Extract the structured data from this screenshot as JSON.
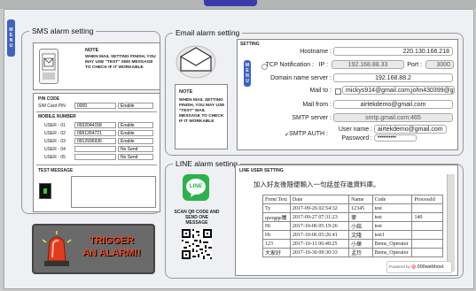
{
  "menu_tab": {
    "letters": [
      "M",
      "E",
      "N",
      "U"
    ]
  },
  "sms": {
    "title": "SMS alarm setting",
    "note_title": "Note",
    "note_text": "When mail setting finish, you may use \"test\" SMS message to check if it workable",
    "pin_label": "PIN code",
    "pin_field_label": "SIM Card PIN",
    "pin_value": "0000",
    "pin_status": "Enable",
    "mobile_label": "Mobile number",
    "users": [
      {
        "label": "USER - 01",
        "number": "0932044158",
        "status": "Enable"
      },
      {
        "label": "USER - 02",
        "number": "0991264721",
        "status": "Enable"
      },
      {
        "label": "USER - 03",
        "number": "0912936936",
        "status": "Enable"
      },
      {
        "label": "USER - 04",
        "number": "",
        "status": "No Send"
      },
      {
        "label": "USER - 05",
        "number": "",
        "status": "No Send"
      }
    ],
    "test_label": "Test message"
  },
  "trigger": {
    "line1": "Trigger",
    "line2": "an alarm!!",
    "color": "#e94a2a"
  },
  "email": {
    "title": "Email alarm setting",
    "setting_label": "Setting",
    "note_title": "Note",
    "note_text": "When mail setting finish, you may use \"test\" mail message to check if it workable",
    "hostname_label": "Hostname :",
    "hostname_value": "220.130.166.218",
    "tcp_label": "TCP Notification :",
    "ip_label": "IP :",
    "ip_value": "192.168.88.33",
    "port_label": "Port :",
    "port_value": "3000",
    "dns_label": "Domain name server :",
    "dns_value": "192.168.88.2",
    "mailto_label": "Mail to :",
    "mailto_value": "mickys914@gmail.com;john430399@gmail.com;mo",
    "mailfrom_label": "Mail from :",
    "mailfrom_value": "airtekdemo@gmail.com",
    "smtp_label": "SMTP server :",
    "smtp_value": "smtp.gmail.com:465",
    "smtpauth_label": "SMTP AUTH :",
    "username_label": "User name :",
    "username_value": "airtekdemo@gmail.com",
    "password_label": "Password :",
    "password_value": "••••••••••"
  },
  "line": {
    "title": "LINE alarm setting",
    "user_setting_label": "LINE user Setting",
    "scan_text": "Scan QR code and send one message",
    "logo_text": "LINE",
    "instruction": "加入好友後隨便輸入一句話並存進資料庫。",
    "headers": [
      "Front Text",
      "Date",
      "Name",
      "Code",
      "ProcessId"
    ],
    "rows": [
      [
        "Ty",
        "2017-09-26 02:54:32",
        "12345",
        "test",
        ""
      ],
      [
        "qwegqe屠",
        "2017-09-27 07:31:23",
        "麥",
        "test",
        "140"
      ],
      [
        "Hi",
        "2017-10-06 05:19:26",
        "小銘",
        "test",
        ""
      ],
      [
        "Hi",
        "2017-10-06 05:26:41",
        "文隆",
        "test1",
        ""
      ],
      [
        "123",
        "2017-10-11 06:40:25",
        "小華",
        "Bems_Operator",
        ""
      ],
      [
        "大家好",
        "2017-10-30 09:30:33",
        "孟玲",
        "Bems_Operator",
        ""
      ]
    ],
    "badge": "000webhost",
    "badge_prefix": "Powered by"
  }
}
